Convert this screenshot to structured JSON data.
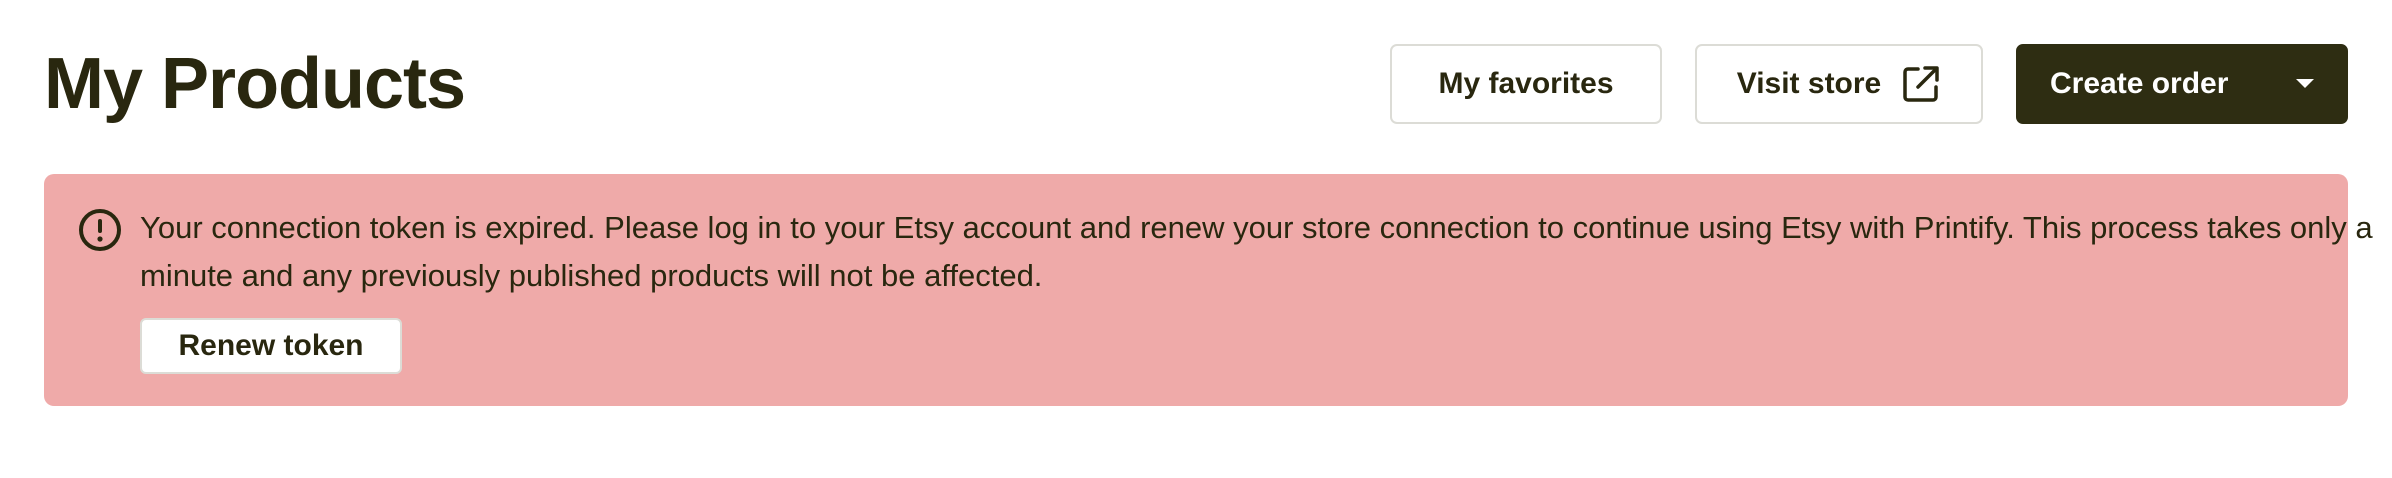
{
  "header": {
    "title": "My Products",
    "favorites_label": "My favorites",
    "visit_store_label": "Visit store",
    "visit_store_icon": "external-link-icon",
    "create_order_label": "Create order",
    "create_order_icon": "caret-down-icon"
  },
  "alert": {
    "icon": "exclamation-circle-icon",
    "message": "Your connection token is expired. Please log in to your Etsy account and renew your store connection to continue using Etsy with Printify. This process takes only a minute and any previously published products will not be affected.",
    "renew_label": "Renew token",
    "background_color": "#efaaa9"
  },
  "colors": {
    "text": "#29270f",
    "primary_button": "#2e2d12",
    "button_border": "#dcdcd6"
  }
}
